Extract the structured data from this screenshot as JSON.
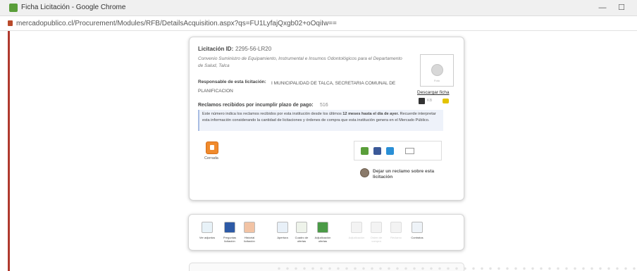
{
  "window": {
    "title": "Ficha Licitación - Google Chrome",
    "minimize": "—",
    "maximize": "☐"
  },
  "address": {
    "url": "mercadopublico.cl/Procurement/Modules/RFB/DetailsAcquisition.aspx?qs=FU1LyfajQxgb02+oOqiIw=="
  },
  "licitacion": {
    "id_label": "Licitación ID:",
    "id_value": "2295-56-LR20",
    "description": "Convenio Suministro de Equipamiento, Instrumental e Insumos Odontológicos para el Departamento de Salud, Talca",
    "responsable_label": "Responsable de esta licitación:",
    "responsable_value": "I MUNICIPALIDAD DE TALCA, SECRETARIA COMUNAL DE PLANIFICACION",
    "reclamos_label": "Reclamos recibidos por incumplir plazo de pago:",
    "reclamos_value": "516",
    "info_pre": "Este número indica los reclamos recibidos por esta institución desde los últimos ",
    "info_bold": "12 meses hasta el día de ayer.",
    "info_post": " Recuerde interpretar esta información considerando la cantidad de licitaciones y órdenes de compra que esta institución genera en el Mercado Público."
  },
  "sidebar": {
    "photo_label": "Foto",
    "download_label": "Descargar ficha",
    "size_label": "KB",
    "icons": [
      "pdf-icon",
      "print-icon"
    ]
  },
  "status": {
    "label": "Cerrada",
    "icon": "lock-icon",
    "color": "#f08a2c"
  },
  "social": {
    "icons": [
      "share-icon",
      "facebook-icon",
      "twitter-icon",
      "email-icon"
    ],
    "colors": [
      "#5a9e3a",
      "#3b5998",
      "#2a8fd6",
      "#999999"
    ]
  },
  "reclamo": {
    "label": "Dejar un reclamo sobre esta licitación"
  },
  "toolbar": {
    "items": [
      {
        "label": "Ver adjuntos",
        "icon": "search-icon",
        "enabled": true
      },
      {
        "label": "Preguntas licitación",
        "icon": "question-icon",
        "enabled": true
      },
      {
        "label": "Historial licitación",
        "icon": "fire-icon",
        "enabled": true
      },
      {
        "label": "Apertura",
        "icon": "open-folder-icon",
        "enabled": true
      },
      {
        "label": "Cuadro de ofertas",
        "icon": "grid-icon",
        "enabled": true
      },
      {
        "label": "Adjudicación ofertas",
        "icon": "checkmark-icon",
        "enabled": true
      },
      {
        "label": "Adjudicación",
        "icon": "question-icon",
        "enabled": false
      },
      {
        "label": "Orden de compra",
        "icon": "document-icon",
        "enabled": false
      },
      {
        "label": "Reclamo",
        "icon": "square-icon",
        "enabled": false
      },
      {
        "label": "Contratos",
        "icon": "contract-icon",
        "enabled": true
      }
    ]
  }
}
